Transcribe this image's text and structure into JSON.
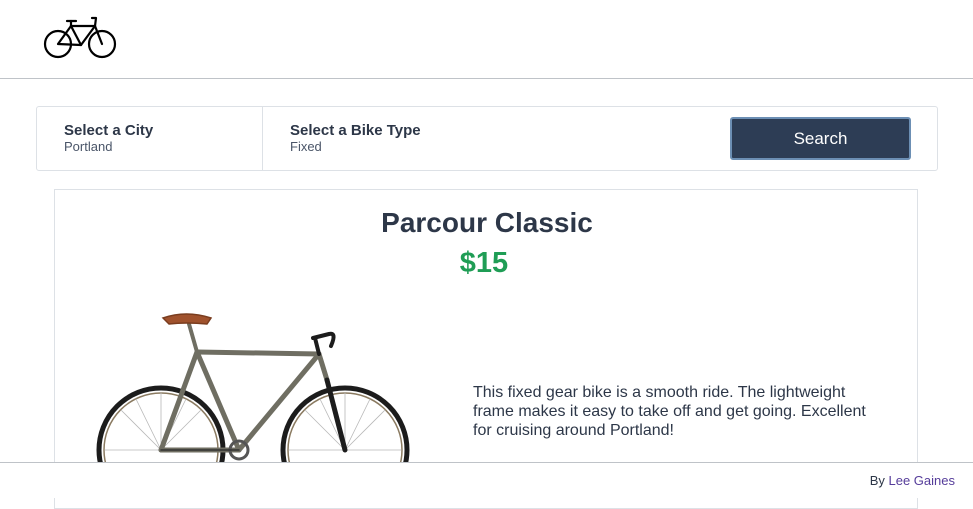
{
  "header": {
    "logo_icon": "bicycle-icon"
  },
  "search": {
    "city_label": "Select a City",
    "city_value": "Portland",
    "type_label": "Select a Bike Type",
    "type_value": "Fixed",
    "button_label": "Search"
  },
  "listing": {
    "name": "Parcour Classic",
    "price": "$15",
    "description": "This fixed gear bike is a smooth ride. The lightweight frame makes it easy to take off and get going. Excellent for cruising around Portland!"
  },
  "footer": {
    "prefix": "By",
    "author": "Lee Gaines"
  },
  "colors": {
    "button_bg": "#2d3d55",
    "price": "#1f9d55",
    "author_link": "#553c9a"
  }
}
